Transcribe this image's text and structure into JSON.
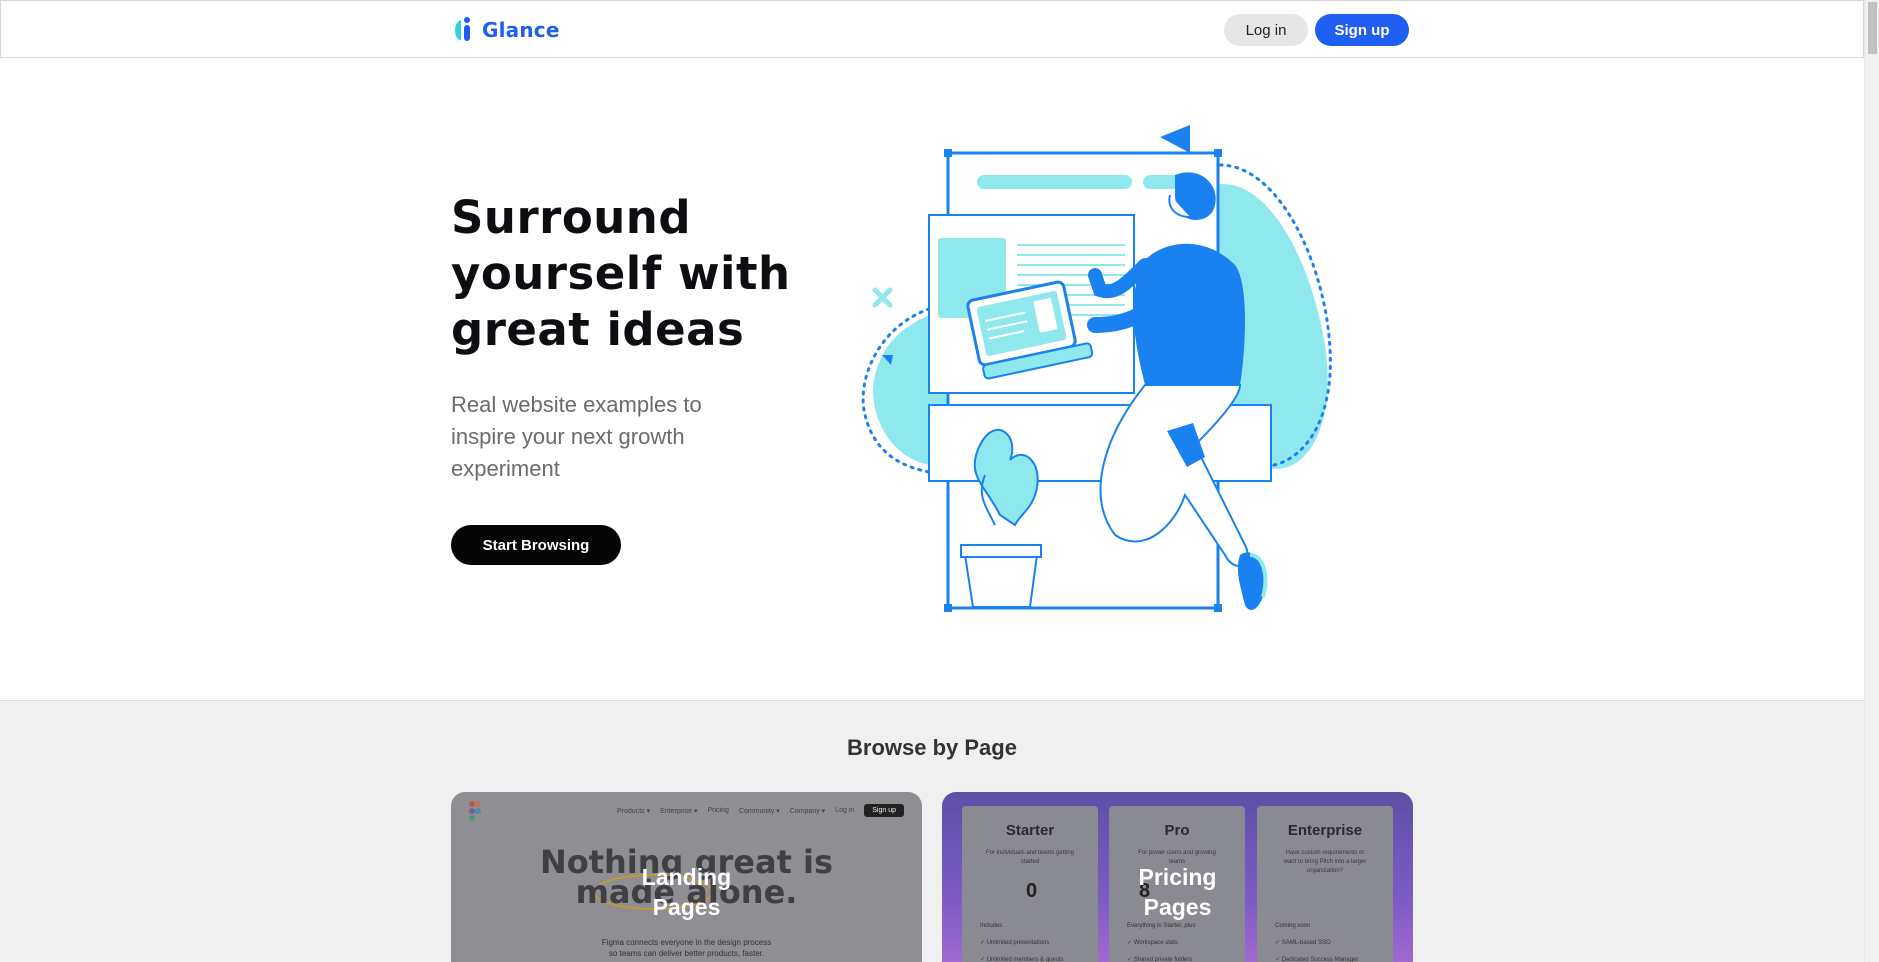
{
  "header": {
    "logo_text": "Glance",
    "login_label": "Log in",
    "signup_label": "Sign up"
  },
  "hero": {
    "title": "Surround yourself with great ideas",
    "subtitle": "Real website examples to inspire your next growth experiment",
    "cta_label": "Start Browsing"
  },
  "browse": {
    "title": "Browse by Page",
    "cards": [
      {
        "label_line1": "Landing",
        "label_line2": "Pages",
        "preview": {
          "nav": [
            "Products ▾",
            "Enterprise ▾",
            "Pricing",
            "Community ▾",
            "Company ▾",
            "Log in"
          ],
          "nav_signup": "Sign up",
          "headline_line1": "Nothing great is",
          "headline_line2": "made alone.",
          "body_line1": "Figma connects everyone in the design process",
          "body_line2": "so teams can deliver better products, faster."
        }
      },
      {
        "label_line1": "Pricing",
        "label_line2": "Pages",
        "preview": {
          "plans": [
            {
              "name": "Starter",
              "blurb": "For individuals and teams getting started",
              "price": "0",
              "list": [
                "Includes",
                "✓ Unlimited presentations",
                "✓ Unlimited members & guests"
              ]
            },
            {
              "name": "Pro",
              "blurb": "For power users and growing teams",
              "price": "8",
              "list": [
                "Everything in Starter, plus",
                "✓ Workspace stats",
                "✓ Shared private folders"
              ]
            },
            {
              "name": "Enterprise",
              "blurb": "Have custom requirements or want to bring Pitch into a larger organization?",
              "price": "",
              "list": [
                "Coming soon",
                "✓ SAML-based SSO",
                "✓ Dedicated Success Manager"
              ]
            }
          ]
        }
      }
    ]
  },
  "colors": {
    "brand_blue": "#1f5ef2",
    "illustration_blue": "#1a82f0",
    "illustration_cyan": "#90e8ef",
    "cta_black": "#050505"
  }
}
